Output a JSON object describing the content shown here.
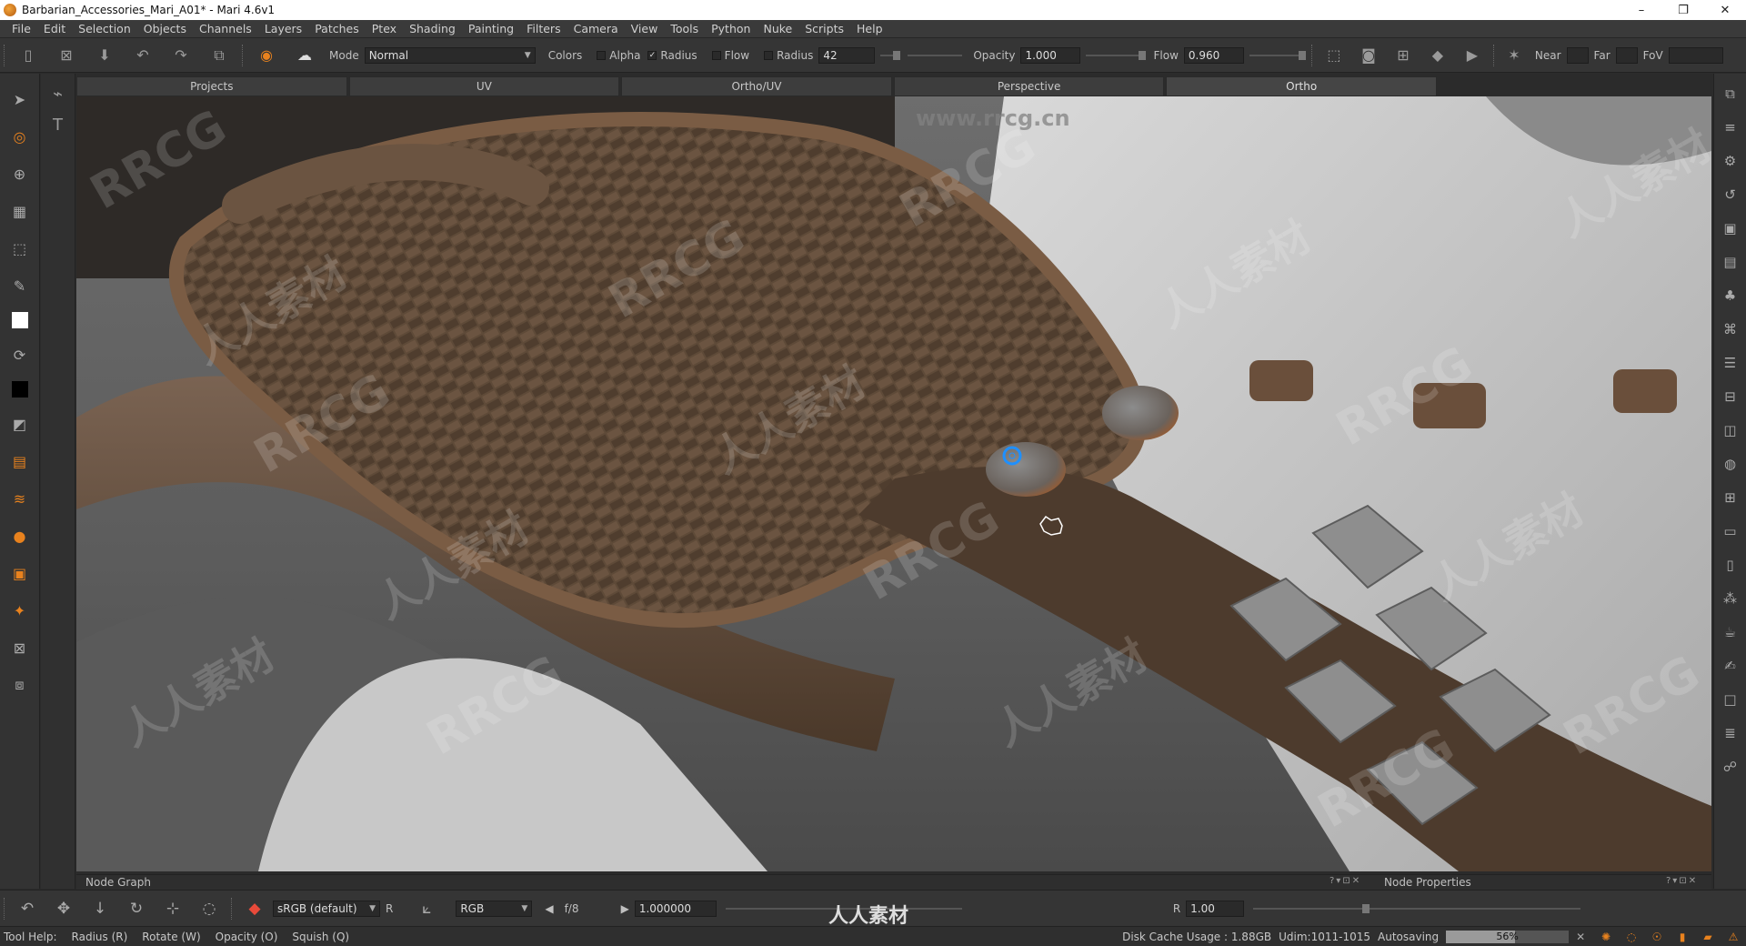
{
  "window": {
    "title": "Barbarian_Accessories_Mari_A01* - Mari 4.6v1",
    "minimize": "–",
    "maximize": "❐",
    "close": "✕"
  },
  "menu": [
    "File",
    "Edit",
    "Selection",
    "Objects",
    "Channels",
    "Layers",
    "Patches",
    "Ptex",
    "Shading",
    "Painting",
    "Filters",
    "Camera",
    "View",
    "Tools",
    "Python",
    "Nuke",
    "Scripts",
    "Help"
  ],
  "toolbar": {
    "mode_label": "Mode",
    "mode_value": "Normal",
    "colors_label": "Colors",
    "alpha_label": "Alpha",
    "radius_check_label": "Radius",
    "flow_check_label": "Flow",
    "radius_label": "Radius",
    "radius_value": "42",
    "opacity_label": "Opacity",
    "opacity_value": "1.000",
    "flow_label": "Flow",
    "flow_value": "0.960",
    "near_label": "Near",
    "far_label": "Far",
    "fov_label": "FoV"
  },
  "tabs": [
    "Projects",
    "UV",
    "Ortho/UV",
    "Perspective",
    "Ortho"
  ],
  "active_tab": "Ortho",
  "watermark": {
    "rrcg": "RRCG",
    "cn": "人人素材",
    "url": "www.rrcg.cn"
  },
  "panels": {
    "left": "Node Graph",
    "right": "Node Properties",
    "controls": "?▾⊡✕"
  },
  "bottom": {
    "colorspace": "sRGB (default)",
    "r_label": "R",
    "channel": "RGB",
    "fstop": "f/8",
    "exposure": "1.000000",
    "r2_label": "R",
    "gamma": "1.00",
    "brand": "人人素材"
  },
  "status": {
    "tool_help": "Tool Help:",
    "radius": "Radius (R)",
    "rotate": "Rotate (W)",
    "opacity": "Opacity (O)",
    "squish": "Squish (Q)",
    "disk_cache": "Disk Cache Usage : 1.88GB",
    "udim": "Udim:1011-1015",
    "autosaving": "Autosaving",
    "progress_pct": "56%",
    "progress_fraction": 0.56
  },
  "colors": {
    "accent": "#e8821e",
    "cursor": "#1e90ff",
    "leather": "#5a4331"
  }
}
